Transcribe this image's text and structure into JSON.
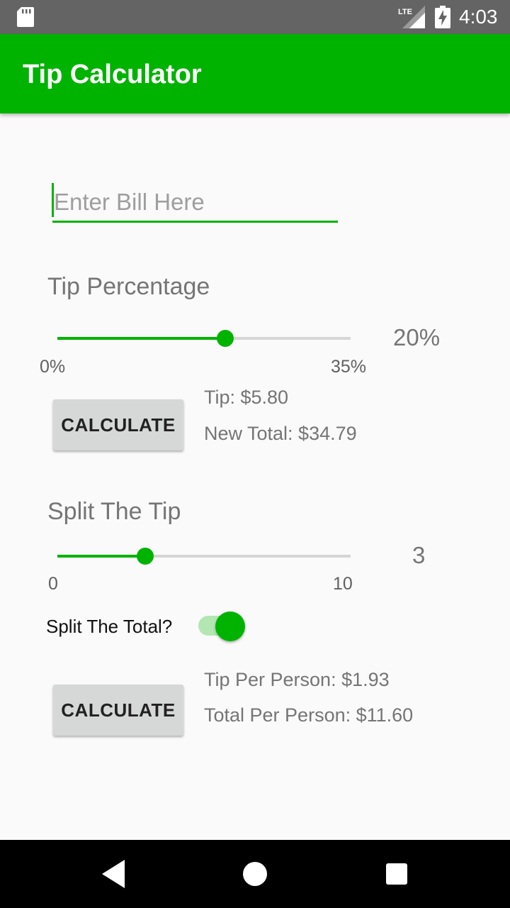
{
  "status_bar": {
    "time": "4:03",
    "network": "LTE",
    "icons": [
      "sd-card-icon",
      "lte-signal-icon",
      "battery-charging-icon"
    ]
  },
  "app_bar": {
    "title": "Tip Calculator"
  },
  "bill": {
    "placeholder": "Enter Bill Here",
    "value": ""
  },
  "tip_section": {
    "label": "Tip Percentage",
    "slider": {
      "min_label": "0%",
      "max_label": "35%",
      "min": 0,
      "max": 35,
      "value": 20,
      "value_label": "20%"
    },
    "calculate_label": "CALCULATE",
    "tip_text": "Tip: $5.80",
    "new_total_text": "New Total: $34.79"
  },
  "split_section": {
    "label": "Split The Tip",
    "slider": {
      "min_label": "0",
      "max_label": "10",
      "min": 0,
      "max": 10,
      "value": 3,
      "value_label": "3"
    },
    "switch_label": "Split The Total?",
    "switch_on": true,
    "calculate_label": "CALCULATE",
    "tip_per_person_text": "Tip Per Person: $1.93",
    "total_per_person_text": "Total Per Person: $11.60"
  },
  "colors": {
    "accent": "#00b300",
    "status_bar": "#646464",
    "background": "#fafafa"
  },
  "nav_bar": {
    "icons": [
      "back-icon",
      "home-icon",
      "recents-icon"
    ]
  }
}
